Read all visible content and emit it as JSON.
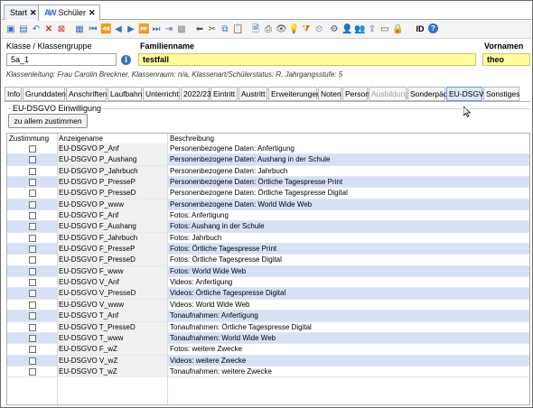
{
  "doc_tabs": [
    {
      "label": "Start",
      "close": "✕"
    },
    {
      "icon": "AW",
      "label": "Schüler",
      "close": "✕"
    }
  ],
  "toolbar": {
    "id_label": "ID"
  },
  "header": {
    "class_label": "Klasse / Klassengruppe",
    "class_value": "5a_1",
    "family_label": "Familienname",
    "family_value": "testfall",
    "first_label": "Vornamen",
    "first_value": "theo",
    "status_line": "Klassenleitung: Frau Carolin Breckner, Klassenraum: n/a, Klassenart/Schülerstatus: R, Jahrgangsstufe: 5"
  },
  "section_tabs": [
    {
      "label": "Info",
      "state": "normal"
    },
    {
      "label": "Grunddaten",
      "state": "normal"
    },
    {
      "label": "Anschriften",
      "state": "normal"
    },
    {
      "label": "Laufbahn",
      "state": "normal"
    },
    {
      "label": "Unterricht",
      "state": "normal"
    },
    {
      "label": "2022/23",
      "state": "normal"
    },
    {
      "label": "Eintritt",
      "state": "normal"
    },
    {
      "label": "Austritt",
      "state": "normal"
    },
    {
      "label": "Erweiterungen",
      "state": "normal"
    },
    {
      "label": "Noten",
      "state": "normal"
    },
    {
      "label": "Person",
      "state": "normal"
    },
    {
      "label": "Ausbildung",
      "state": "disabled"
    },
    {
      "label": "Sonderpäd.",
      "state": "normal"
    },
    {
      "label": "EU-DSGVO",
      "state": "active"
    },
    {
      "label": "Sonstiges",
      "state": "normal"
    }
  ],
  "group": {
    "title": "EU-DSGVO Einwilligung",
    "button_label": "zu allem zustimmen"
  },
  "table": {
    "headers": {
      "consent": "Zustimmung",
      "name": "Anzeigename",
      "desc": "Beschreibung"
    },
    "rows": [
      {
        "name": "EU-DSGVO P_Anf",
        "desc": "Personenbezogene Daten: Anfertigung",
        "checked": false
      },
      {
        "name": "EU-DSGVO P_Aushang",
        "desc": "Personenbezogene Daten: Aushang in der Schule",
        "checked": false
      },
      {
        "name": "EU-DSGVO P_Jahrbuch",
        "desc": "Personenbezogene Daten: Jahrbuch",
        "checked": false
      },
      {
        "name": "EU-DSGVO P_PresseP",
        "desc": "Personenbezogene Daten: Örtliche Tagespresse Print",
        "checked": false
      },
      {
        "name": "EU-DSGVO P_PresseD",
        "desc": "Personenbezogene Daten: Örtliche Tagespresse Digital",
        "checked": false
      },
      {
        "name": "EU-DSGVO P_www",
        "desc": "Personenbezogene Daten: World Wide Web",
        "checked": false
      },
      {
        "name": "EU-DSGVO F_Anf",
        "desc": "Fotos: Anfertigung",
        "checked": false
      },
      {
        "name": "EU-DSGVO F_Aushang",
        "desc": "Fotos: Aushang in der Schule",
        "checked": false
      },
      {
        "name": "EU-DSGVO F_Jahrbuch",
        "desc": "Fotos: Jahrbuch",
        "checked": false
      },
      {
        "name": "EU-DSGVO F_PresseP",
        "desc": "Fotos: Örtliche Tagespresse Print",
        "checked": false
      },
      {
        "name": "EU-DSGVO F_PresseD",
        "desc": "Fotos: Örtliche Tagespresse Digital",
        "checked": false
      },
      {
        "name": "EU-DSGVO F_www",
        "desc": "Fotos: World Wide Web",
        "checked": false
      },
      {
        "name": "EU-DSGVO V_Anf",
        "desc": "Videos: Anfertigung",
        "checked": false
      },
      {
        "name": "EU-DSGVO V_PresseD",
        "desc": "Videos: Örtliche Tagespresse Digital",
        "checked": false
      },
      {
        "name": "EU-DSGVO V_www",
        "desc": "Videos: World Wide Web",
        "checked": false
      },
      {
        "name": "EU-DSGVO T_Anf",
        "desc": "Tonaufnahmen: Anfertigung",
        "checked": false
      },
      {
        "name": "EU-DSGVO T_PresseD",
        "desc": "Tonaufnahmen: Örtliche Tagespresse Digital",
        "checked": false
      },
      {
        "name": "EU-DSGVO T_www",
        "desc": "Tonaufnahmen: World Wide Web",
        "checked": false
      },
      {
        "name": "EU-DSGVO F_wZ",
        "desc": "Fotos: weitere Zwecke",
        "checked": false
      },
      {
        "name": "EU-DSGVO V_wZ",
        "desc": "Videos: weitere Zwecke",
        "checked": false
      },
      {
        "name": "EU-DSGVO T_wZ",
        "desc": "Tonaufnahmen: weitere Zwecke",
        "checked": false
      }
    ]
  },
  "colors": {
    "field_yellow": "#fefd9a",
    "row_alt": "#d6e1f5",
    "active_tab": "#dce8fa"
  }
}
